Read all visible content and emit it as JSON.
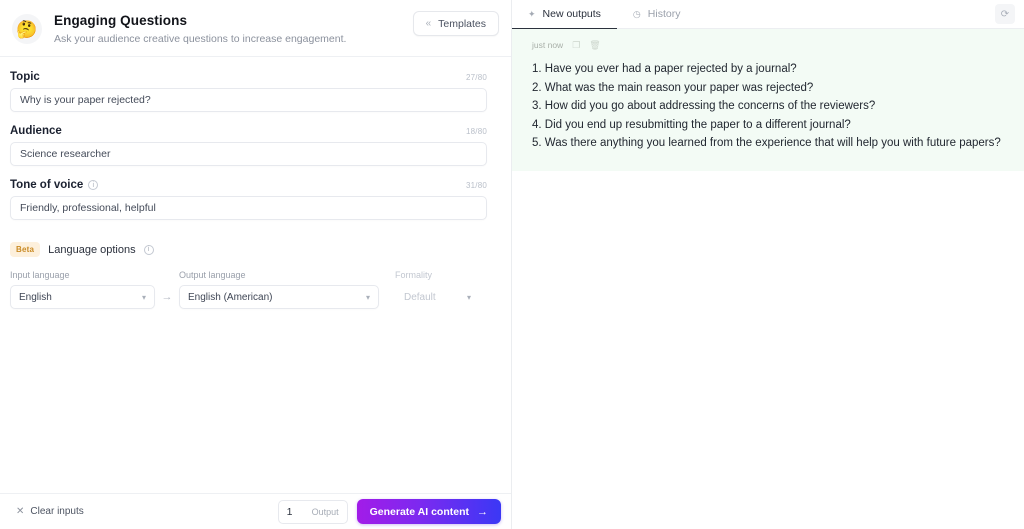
{
  "header": {
    "emoji": "🤔",
    "emoji_name": "thinking-face-emoji",
    "title": "Engaging Questions",
    "subtitle": "Ask your audience creative questions to increase engagement.",
    "templates_label": "Templates",
    "templates_icon": "chevron-double-left-icon"
  },
  "form": {
    "fields": [
      {
        "label": "Topic",
        "value": "Why is your paper rejected?",
        "counter": "27/80",
        "has_info": false
      },
      {
        "label": "Audience",
        "value": "Science researcher",
        "counter": "18/80",
        "has_info": false
      },
      {
        "label": "Tone of voice",
        "value": "Friendly, professional, helpful",
        "counter": "31/80",
        "has_info": true
      }
    ],
    "language": {
      "badge": "Beta",
      "title": "Language options",
      "input_label": "Input language",
      "input_value": "English",
      "arrow": "→",
      "output_label": "Output language",
      "output_value": "English (American)",
      "formality_label": "Formality",
      "formality_value": "Default"
    }
  },
  "bottom": {
    "clear_label": "Clear inputs",
    "clear_icon": "close-x-icon",
    "output_count": "1",
    "output_label": "Output",
    "generate_label": "Generate AI content",
    "generate_arrow": "→"
  },
  "output_panel": {
    "tabs": [
      {
        "label": "New outputs",
        "icon": "sparkle-icon",
        "active": true
      },
      {
        "label": "History",
        "icon": "clock-icon",
        "active": false
      }
    ],
    "refresh_icon": "refresh-icon",
    "result": {
      "timestamp": "just now",
      "copy_icon": "copy-icon",
      "delete_icon": "trash-icon",
      "lines": [
        "1. Have you ever had a paper rejected by a journal?",
        "2. What was the main reason your paper was rejected?",
        "3. How did you go about addressing the concerns of the reviewers?",
        "4. Did you end up resubmitting the paper to a different journal?",
        "5. Was there anything you learned from the experience that will help you with future papers?"
      ]
    }
  },
  "colors": {
    "accent_purple": "#a21ce8",
    "accent_blue": "#3b38f5",
    "beta_badge_bg": "#fdf0dc",
    "beta_badge_fg": "#c98a24",
    "output_card_bg": "#f3fbf5"
  }
}
